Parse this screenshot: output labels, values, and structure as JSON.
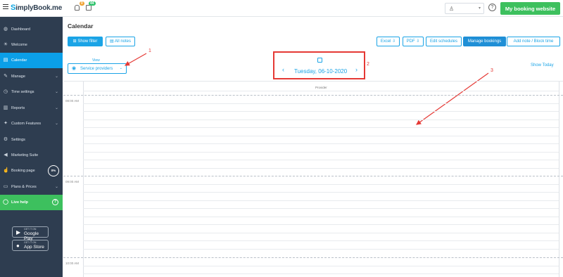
{
  "topbar": {
    "logo_initial": "S",
    "logo_text": "implyBook.me",
    "notif_count": "0",
    "task_count": "44",
    "my_booking_label": "My booking website"
  },
  "sidebar": {
    "items": [
      {
        "label": "Dashboard",
        "icon": "dashboard-icon",
        "glyph": "◍",
        "chevron": ""
      },
      {
        "label": "Welcome",
        "icon": "lightbulb-icon",
        "glyph": "☀",
        "chevron": ""
      },
      {
        "label": "Calendar",
        "icon": "calendar-icon",
        "glyph": "▤",
        "chevron": ""
      },
      {
        "label": "Manage",
        "icon": "pencil-icon",
        "glyph": "✎",
        "chevron": "⌄"
      },
      {
        "label": "Time settings",
        "icon": "clock-icon",
        "glyph": "◷",
        "chevron": "⌄"
      },
      {
        "label": "Reports",
        "icon": "chart-icon",
        "glyph": "▥",
        "chevron": "⌄"
      },
      {
        "label": "Custom Features",
        "icon": "puzzle-icon",
        "glyph": "✦",
        "chevron": "⌄"
      },
      {
        "label": "Settings",
        "icon": "gear-icon",
        "glyph": "⚙",
        "chevron": ""
      },
      {
        "label": "Marketing Suite",
        "icon": "megaphone-icon",
        "glyph": "◀",
        "chevron": ""
      },
      {
        "label": "Booking page",
        "icon": "thumbs-up-icon",
        "glyph": "☝",
        "chevron": ""
      },
      {
        "label": "Plans & Prices",
        "icon": "price-icon",
        "glyph": "▭",
        "chevron": "⌄"
      }
    ],
    "booking_progress": "0%",
    "live_help": "Live help",
    "live_help_q": "?",
    "google_play_small": "GET IT ON",
    "google_play": "Google Play",
    "app_store_small": "GET IT ON",
    "app_store": "App Store"
  },
  "main": {
    "title": "Calendar",
    "show_filter": "Show filter",
    "all_notes": "All notes",
    "excel": "Excel",
    "pdf": "PDF",
    "edit_schedules": "Edit schedules",
    "manage_bookings": "Manage bookings",
    "add_note": "Add note / Block time",
    "view_label": "View",
    "view_value": "Service providers",
    "date": "Tuesday, 06-10-2020",
    "show_today": "Show Today",
    "provider_header": "Provider",
    "times": [
      "08:00 AM",
      "09:00 AM",
      "10:00 AM"
    ]
  },
  "annotations": [
    "1",
    "2",
    "3"
  ],
  "colors": {
    "sidebar_bg": "#2e3d50",
    "accent": "#1ba4e6",
    "green": "#3dc05e",
    "annotation_red": "#e53935"
  }
}
